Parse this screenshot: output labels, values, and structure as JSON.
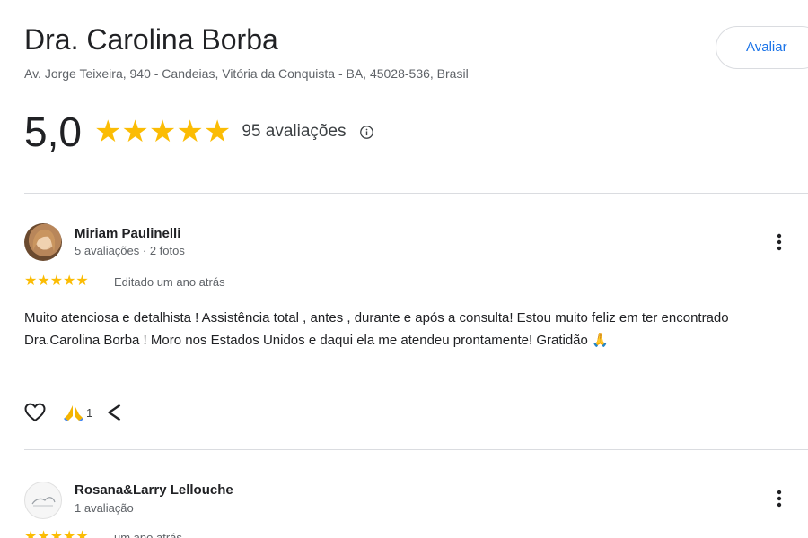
{
  "place": {
    "name": "Dra. Carolina Borba",
    "address": "Av. Jorge Teixeira, 940 - Candeias, Vitória da Conquista - BA, 45028-536, Brasil",
    "review_button": "Avaliar"
  },
  "rating": {
    "score": "5,0",
    "stars": "★★★★★",
    "count": "95 avaliações"
  },
  "reviews": [
    {
      "author": "Miriam Paulinelli",
      "meta": "5 avaliações · 2 fotos",
      "stars": "★★★★★",
      "date": "Editado um ano atrás",
      "text": "Muito atenciosa e detalhista ! Assistência total , antes , durante e após a consulta! Estou muito feliz em ter encontrado Dra.Carolina Borba ! Moro nos Estados Unidos e daqui ela me atendeu prontamente! Gratidão 🙏",
      "reaction_count": "1"
    },
    {
      "author": "Rosana&Larry Lellouche",
      "meta": "1 avaliação",
      "stars": "★★★★★",
      "date": "um ano atrás"
    }
  ],
  "colors": {
    "star": "#fbbc04",
    "accent": "#1a73e8",
    "divider": "#dadce0"
  },
  "icons": [
    "info-icon",
    "more-vert-icon",
    "heart-icon",
    "pray-icon",
    "share-icon"
  ]
}
